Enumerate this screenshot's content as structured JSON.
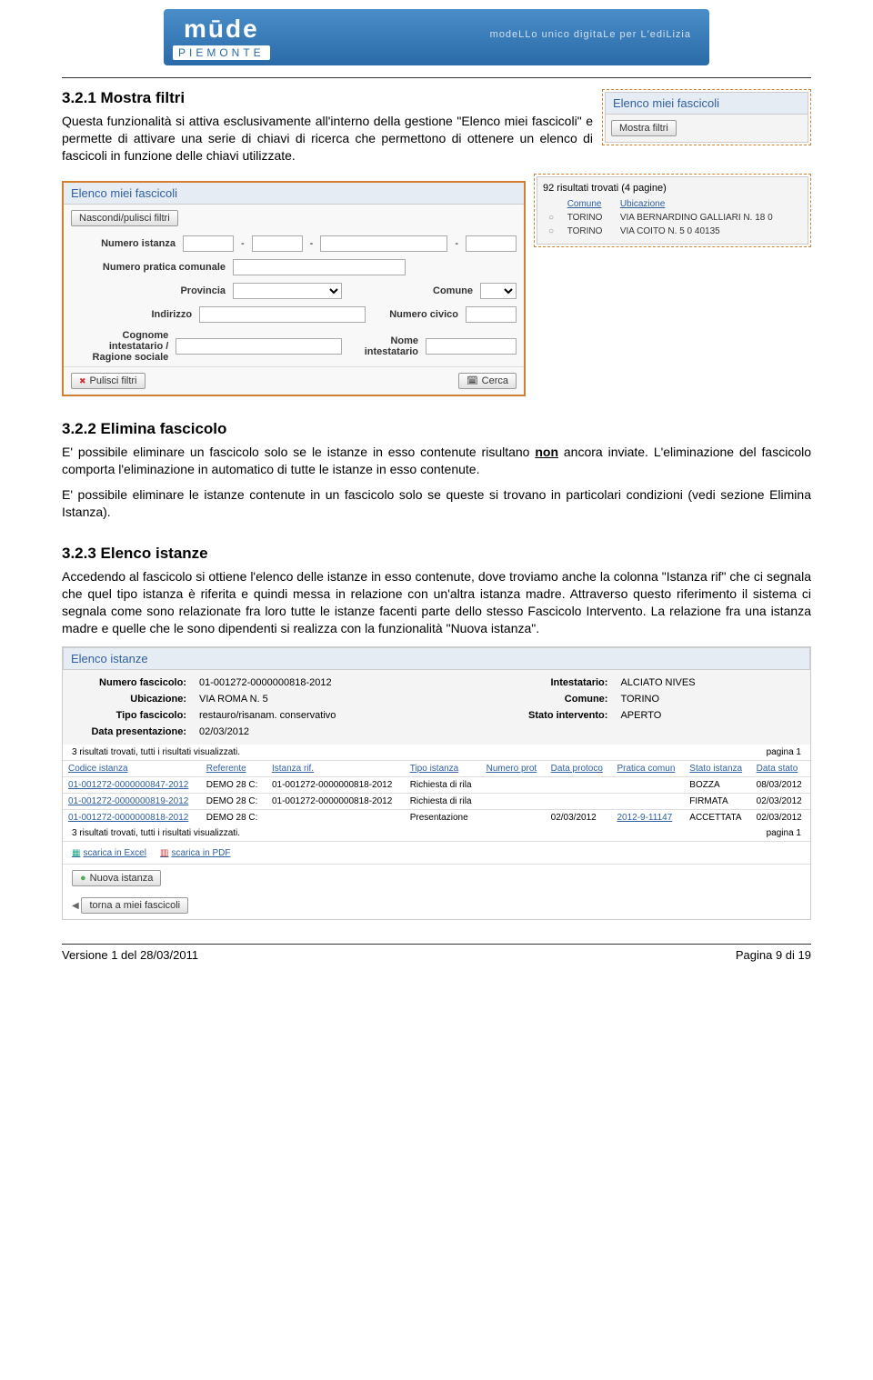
{
  "logo": {
    "brand": "mūde",
    "region": "PIEMONTE",
    "tagline": "modeLLo unico digitaLe per L'ediLizia"
  },
  "sec1": {
    "title": "3.2.1 Mostra filtri",
    "body": "Questa funzionalità si attiva esclusivamente all'interno della gestione \"Elenco miei fascicoli\" e permette di attivare una serie di chiavi di ricerca che permettono di ottenere un elenco di fascicoli in funzione delle chiavi utilizzate."
  },
  "side1": {
    "title": "Elenco miei fascicoli",
    "btn": "Mostra filtri",
    "meta": "92 risultati trovati (4 pagine)",
    "cols": {
      "comune": "Comune",
      "ubic": "Ubicazione"
    },
    "rows": [
      {
        "comune": "TORINO",
        "ubic": "VIA BERNARDINO GALLIARI N. 18 0"
      },
      {
        "comune": "TORINO",
        "ubic": "VIA COITO N. 5 0 40135"
      }
    ]
  },
  "form": {
    "title": "Elenco miei fascicoli",
    "hide": "Nascondi/pulisci filtri",
    "numIst": "Numero istanza",
    "numPrat": "Numero pratica comunale",
    "prov": "Provincia",
    "comune": "Comune",
    "indir": "Indirizzo",
    "civ": "Numero civico",
    "cogn": "Cognome intestatario / Ragione sociale",
    "nome": "Nome intestatario",
    "pulisci": "Pulisci filtri",
    "cerca": "Cerca"
  },
  "sec2": {
    "title": "3.2.2 Elimina fascicolo",
    "p1a": "E' possibile eliminare un fascicolo solo se le istanze in esso contenute risultano ",
    "non": "non",
    "p1b": " ancora inviate. L'eliminazione del fascicolo comporta l'eliminazione in automatico di tutte le istanze in esso contenute.",
    "p2": "E' possibile eliminare le istanze contenute in un fascicolo solo se queste si trovano in particolari condizioni (vedi sezione Elimina Istanza)."
  },
  "sec3": {
    "title": "3.2.3 Elenco istanze",
    "body": "Accedendo al fascicolo si ottiene l'elenco delle istanze in esso contenute, dove troviamo anche la colonna \"Istanza rif\" che ci segnala che quel tipo istanza è riferita e quindi messa in relazione con un'altra istanza madre. Attraverso questo riferimento il sistema ci segnala come sono relazionate fra loro tutte le istanze facenti parte dello stesso Fascicolo Intervento. La relazione fra una istanza madre e quelle che le sono dipendenti si realizza con la funzionalità \"Nuova istanza\"."
  },
  "ist": {
    "title": "Elenco istanze",
    "labels": {
      "numFasc": "Numero fascicolo:",
      "intest": "Intestatario:",
      "ubic": "Ubicazione:",
      "comune": "Comune:",
      "tipo": "Tipo fascicolo:",
      "stato": "Stato intervento:",
      "dataP": "Data presentazione:"
    },
    "vals": {
      "numFasc": "01-001272-0000000818-2012",
      "intest": "ALCIATO NIVES",
      "ubic": "VIA ROMA N. 5",
      "comune": "TORINO",
      "tipo": "restauro/risanam. conservativo",
      "stato": "APERTO",
      "dataP": "02/03/2012"
    },
    "meta": "3 risultati trovati, tutti i risultati visualizzati.",
    "pagina": "pagina 1",
    "cols": {
      "cod": "Codice istanza",
      "ref": "Referente",
      "rif": "Istanza rif.",
      "tipo": "Tipo istanza",
      "nprot": "Numero prot",
      "dprot": "Data protoco",
      "prat": "Pratica comun",
      "stato": "Stato istanza",
      "dstato": "Data stato"
    },
    "rows": [
      {
        "cod": "01-001272-0000000847-2012",
        "ref": "DEMO 28 C:",
        "rif": "01-001272-0000000818-2012",
        "tipo": "Richiesta di rila",
        "nprot": "",
        "dprot": "",
        "prat": "",
        "stato": "BOZZA",
        "dstato": "08/03/2012"
      },
      {
        "cod": "01-001272-0000000819-2012",
        "ref": "DEMO 28 C:",
        "rif": "01-001272-0000000818-2012",
        "tipo": "Richiesta di rila",
        "nprot": "",
        "dprot": "",
        "prat": "",
        "stato": "FIRMATA",
        "dstato": "02/03/2012"
      },
      {
        "cod": "01-001272-0000000818-2012",
        "ref": "DEMO 28 C:",
        "rif": "",
        "tipo": "Presentazione",
        "nprot": "",
        "dprot": "02/03/2012",
        "prat": "2012-9-11147",
        "stato": "ACCETTATA",
        "dstato": "02/03/2012"
      }
    ],
    "excel": "scarica in Excel",
    "pdf": "scarica in PDF",
    "nuova": "Nuova istanza",
    "back": "torna a miei fascicoli"
  },
  "footer": {
    "left": "Versione 1 del 28/03/2011",
    "right": "Pagina 9 di 19"
  }
}
